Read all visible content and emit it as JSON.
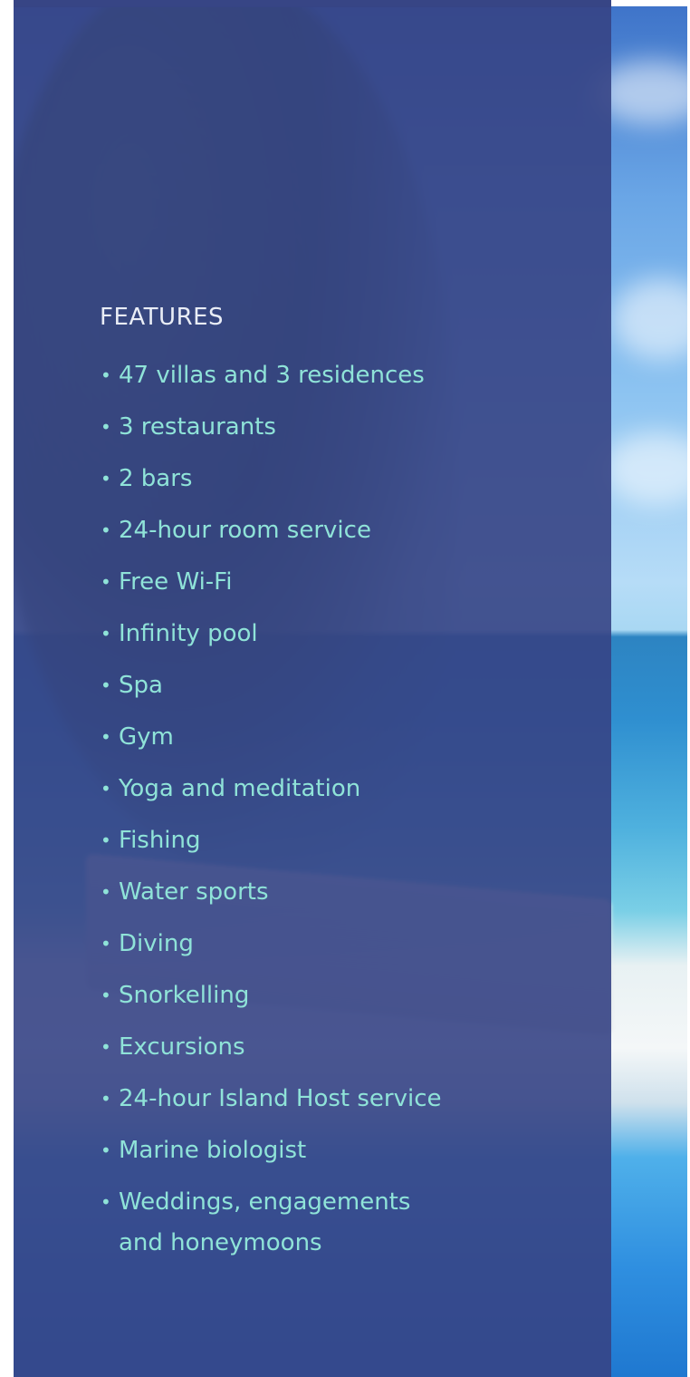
{
  "features": {
    "title": "FEATURES",
    "bullet": "•",
    "items": [
      "47 villas and 3 residences",
      "3 restaurants",
      "2 bars",
      "24-hour room service",
      "Free Wi-Fi",
      "Infinity pool",
      "Spa",
      "Gym",
      "Yoga and meditation",
      "Fishing",
      "Water sports",
      "Diving",
      "Snorkelling",
      "Excursions",
      "24-hour Island Host service",
      "Marine biologist"
    ],
    "last_item_line1": "Weddings, engagements",
    "last_item_line2": "and honeymoons"
  },
  "colors": {
    "panel": "#364485",
    "title_text": "#e9edf6",
    "item_text": "#8fe3d8"
  }
}
